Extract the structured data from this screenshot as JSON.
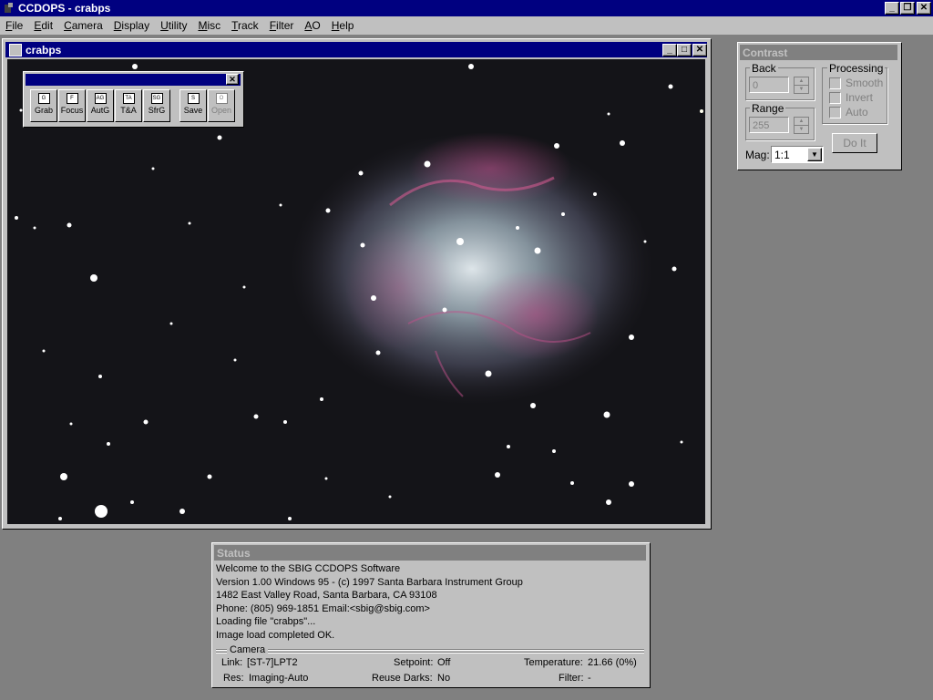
{
  "app": {
    "title": "CCDOPS - crabps",
    "controls": {
      "minimize": "_",
      "restore": "❐",
      "close": "✕"
    }
  },
  "menu": [
    {
      "label": "File",
      "key": "F",
      "rest": "ile"
    },
    {
      "label": "Edit",
      "key": "E",
      "rest": "dit"
    },
    {
      "label": "Camera",
      "key": "C",
      "rest": "amera"
    },
    {
      "label": "Display",
      "key": "D",
      "rest": "isplay"
    },
    {
      "label": "Utility",
      "key": "U",
      "rest": "tility"
    },
    {
      "label": "Misc",
      "key": "M",
      "rest": "isc"
    },
    {
      "label": "Track",
      "key": "T",
      "rest": "rack"
    },
    {
      "label": "Filter",
      "key": "F",
      "rest": "ilter",
      "pre": ""
    },
    {
      "label": "AO",
      "key": "A",
      "rest": "O"
    },
    {
      "label": "Help",
      "key": "H",
      "rest": "elp"
    }
  ],
  "image_window": {
    "title": "crabps",
    "controls": {
      "minimize": "_",
      "maximize": "□",
      "close": "✕"
    }
  },
  "toolbar": {
    "close": "✕",
    "buttons": [
      {
        "label": "Grab",
        "icon": "G",
        "enabled": true
      },
      {
        "label": "Focus",
        "icon": "F",
        "enabled": true
      },
      {
        "label": "AutG",
        "icon": "AG",
        "enabled": true
      },
      {
        "label": "T&A",
        "icon": "TA",
        "enabled": true
      },
      {
        "label": "SfrG",
        "icon": "SG",
        "enabled": true
      },
      {
        "label": "Save",
        "icon": "S",
        "enabled": true
      },
      {
        "label": "Open",
        "icon": "O",
        "enabled": false
      }
    ]
  },
  "contrast": {
    "title": "Contrast",
    "back_label": "Back",
    "back_value": "0",
    "range_label": "Range",
    "range_value": "255",
    "processing_label": "Processing",
    "smooth_label": "Smooth",
    "invert_label": "Invert",
    "auto_label": "Auto",
    "doit_label": "Do It",
    "mag_label": "Mag:",
    "mag_value": "1:1"
  },
  "status": {
    "title": "Status",
    "lines": [
      "Welcome to the SBIG CCDOPS Software",
      "Version 1.00 Windows 95 - (c) 1997 Santa Barbara Instrument Group",
      "1482 East Valley Road, Santa Barbara, CA 93108",
      "Phone: (805) 969-1851 Email:<sbig@sbig.com>",
      "Loading file \"crabps\"...",
      "Image load completed OK."
    ],
    "camera_label": "Camera",
    "link_label": "Link:",
    "link_value": "[ST-7]LPT2",
    "setpoint_label": "Setpoint:",
    "setpoint_value": "Off",
    "temperature_label": "Temperature:",
    "temperature_value": "21.66 (0%)",
    "res_label": "Res:",
    "res_value": "Imaging-Auto",
    "reuse_label": "Reuse Darks:",
    "reuse_value": "No",
    "filter_label": "Filter:",
    "filter_value": "-"
  },
  "colors": {
    "title_active": "#000080",
    "title_inactive": "#808080",
    "face": "#c0c0c0",
    "desktop": "#808080",
    "sky": "#111114"
  }
}
